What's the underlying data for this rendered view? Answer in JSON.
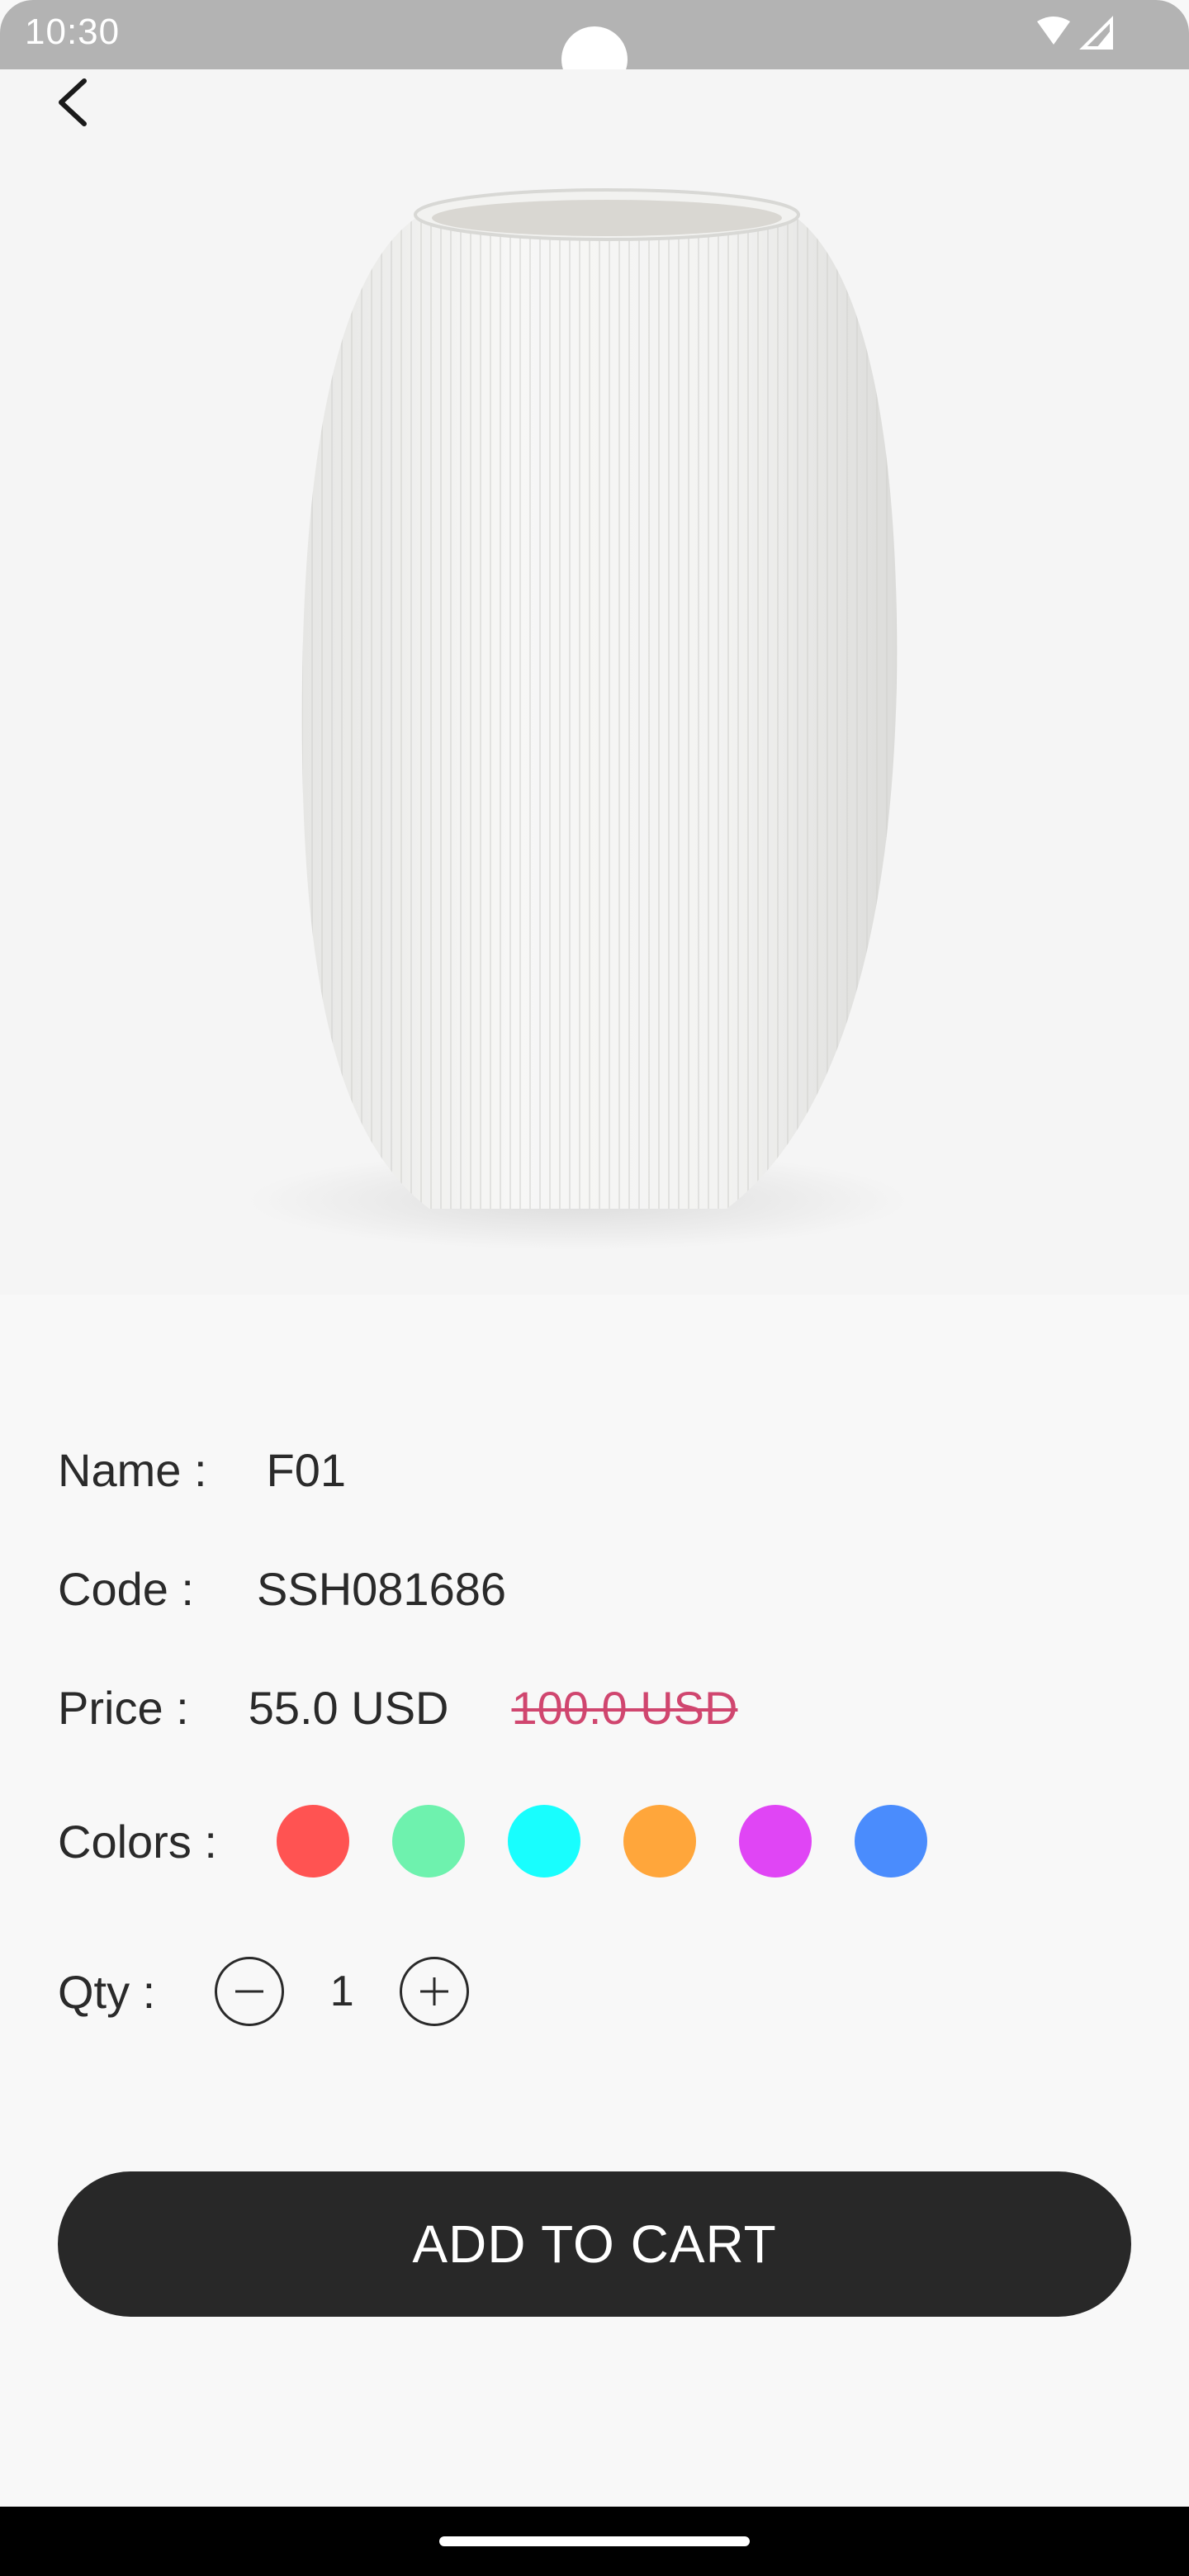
{
  "status_bar": {
    "time": "10:30",
    "icons": [
      "wifi-icon",
      "signal-icon"
    ]
  },
  "navigation": {
    "back_icon": "chevron-left-icon"
  },
  "product": {
    "image": "white-ribbed-vase",
    "name_label": "Name :",
    "name_value": "F01",
    "code_label": "Code :",
    "code_value": "SSH081686",
    "price_label": "Price :",
    "price_value": "55.0 USD",
    "old_price_value": "100.0 USD",
    "colors_label": "Colors :",
    "colors": [
      "#ff5352",
      "#6ef2ae",
      "#18fefe",
      "#ffa63b",
      "#e045f5",
      "#4a8cfd"
    ],
    "qty_label": "Qty :",
    "qty_value": "1"
  },
  "actions": {
    "add_to_cart_label": "ADD TO CART"
  },
  "theme": {
    "accent": "#282828",
    "strike_price": "#d0466f"
  }
}
